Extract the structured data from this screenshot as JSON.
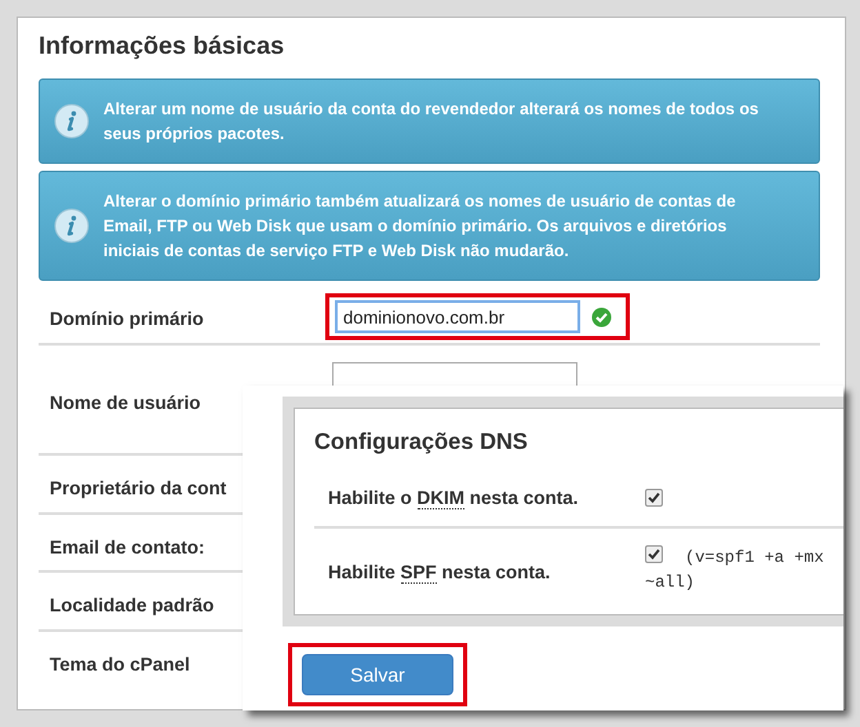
{
  "title": "Informações básicas",
  "alerts": [
    {
      "text": "Alterar um nome de usuário da conta do revendedor alterará os nomes de todos os seus próprios pacotes."
    },
    {
      "text": "Alterar o domínio primário também atualizará os nomes de usuário de contas de Email, FTP ou Web Disk que usam o domínio primário. Os arquivos e diretórios iniciais de contas de serviço FTP e Web Disk não mudarão."
    }
  ],
  "fields": [
    {
      "label": "Domínio primário",
      "kind": "text",
      "value": "dominionovo.com.br",
      "valid": true,
      "highlighted": true
    },
    {
      "label": "Nome de usuário",
      "kind": "text",
      "highlighted": false
    },
    {
      "label": "Proprietário da cont",
      "kind": "label"
    },
    {
      "label": "Email de contato:",
      "kind": "label"
    },
    {
      "label": "Localidade padrão",
      "kind": "label"
    },
    {
      "label": "Tema do cPanel",
      "kind": "label"
    }
  ],
  "dns_dialog": {
    "title": "Configurações DNS",
    "options": [
      {
        "prefix": "Habilite o",
        "abbr": "DKIM",
        "suffix": "nesta conta.",
        "checked": true
      },
      {
        "prefix": "Habilite",
        "abbr": "SPF",
        "suffix": "nesta conta.",
        "checked": true,
        "note_lines": [
          "(v=spf1 +a +mx",
          "~all)"
        ]
      }
    ],
    "save_button": {
      "label": "Salvar",
      "highlighted": true
    }
  }
}
